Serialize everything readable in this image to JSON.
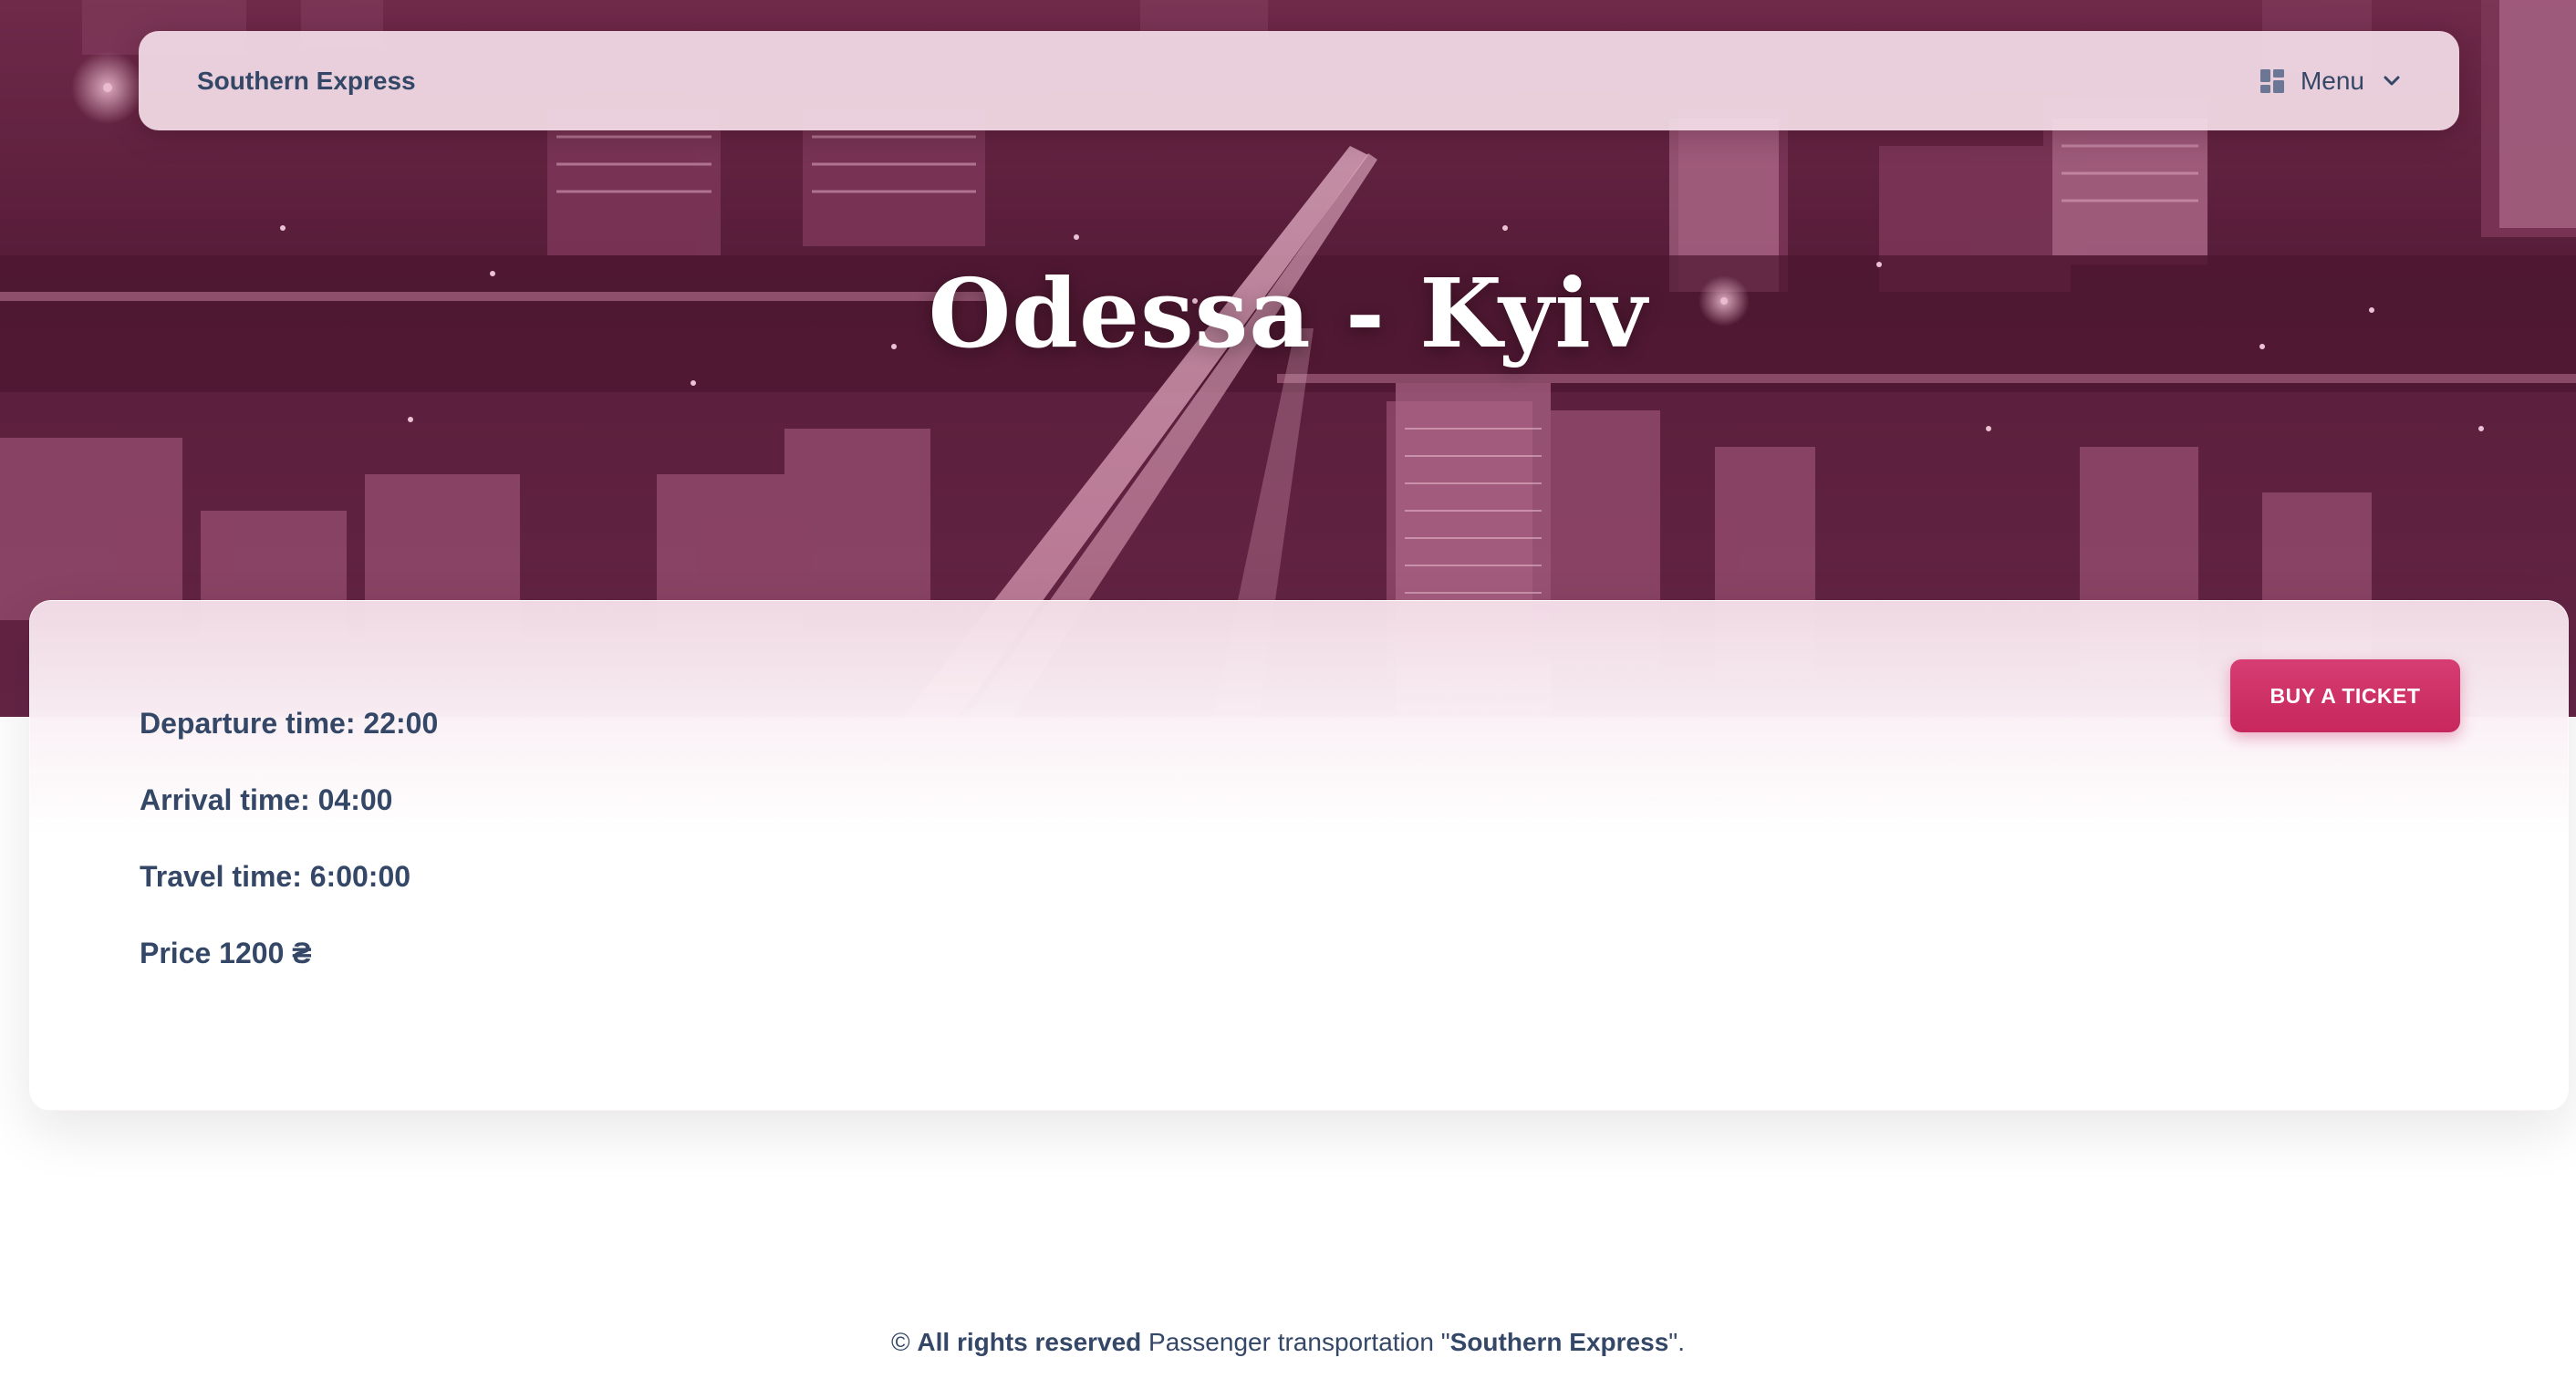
{
  "navbar": {
    "brand": "Southern Express",
    "menu_label": "Menu",
    "menu_icon": "grid-icon",
    "menu_chevron_icon": "chevron-down-icon"
  },
  "hero": {
    "title": "Odessa - Kyiv"
  },
  "trip": {
    "departure": "Departure time: 22:00",
    "arrival": "Arrival time: 04:00",
    "travel": "Travel time: 6:00:00",
    "price": "Price 1200 ₴"
  },
  "actions": {
    "buy_label": "BUY A TICKET"
  },
  "footer": {
    "copyright_symbol": "©",
    "rights": "All rights reserved",
    "text": " Passenger transportation \"",
    "company": "Southern Express",
    "tail": "\"."
  },
  "colors": {
    "accent": "#d63d72",
    "text": "#344767",
    "hero_tint": "#4a1730"
  }
}
